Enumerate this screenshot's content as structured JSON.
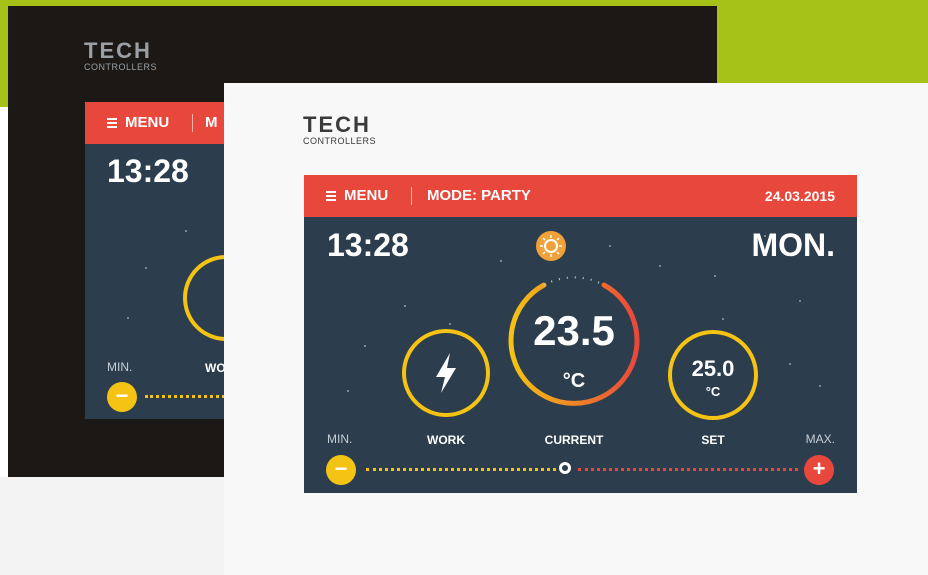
{
  "brand": {
    "name": "TECH",
    "subtitle": "CONTROLLERS"
  },
  "header": {
    "menu_label": "MENU",
    "mode_label": "MODE: PARTY",
    "date": "24.03.2015",
    "back_mode_partial": "M"
  },
  "status": {
    "time": "13:28",
    "day": "MON."
  },
  "dials": {
    "work": {
      "caption": "WORK",
      "icon": "lightning-bolt-icon"
    },
    "current": {
      "caption": "CURRENT",
      "value": "23.5",
      "unit": "°C"
    },
    "set": {
      "caption": "SET",
      "value": "25.0",
      "unit": "°C"
    },
    "back_work_partial": "WO"
  },
  "slider": {
    "min_label": "MIN.",
    "max_label": "MAX.",
    "minus_symbol": "−",
    "plus_symbol": "+"
  },
  "colors": {
    "accent": "#e8483b",
    "screen": "#2c3d4d",
    "yellow": "#f5c313",
    "brand_green": "#a6c219"
  }
}
